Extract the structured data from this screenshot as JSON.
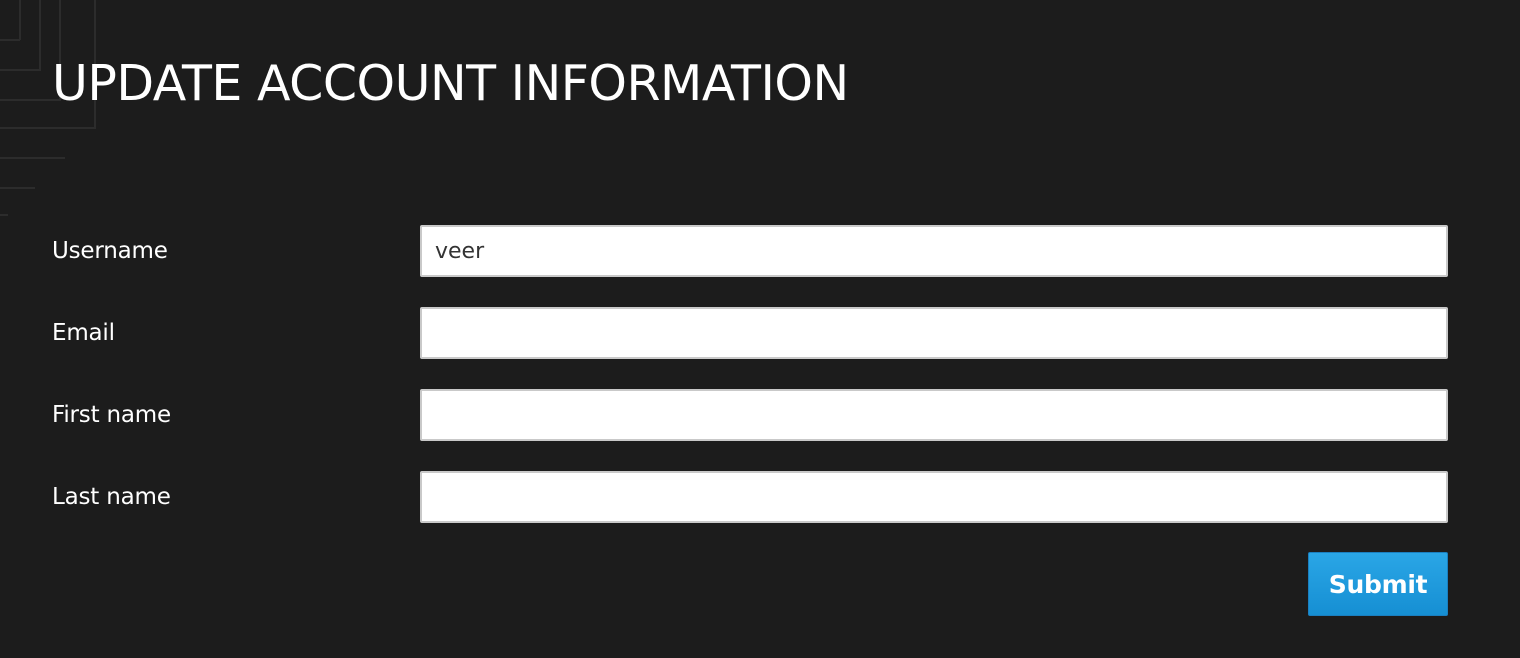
{
  "page": {
    "title": "UPDATE ACCOUNT INFORMATION"
  },
  "form": {
    "fields": [
      {
        "label": "Username",
        "value": "veer",
        "placeholder": ""
      },
      {
        "label": "Email",
        "value": "",
        "placeholder": ""
      },
      {
        "label": "First name",
        "value": "",
        "placeholder": ""
      },
      {
        "label": "Last name",
        "value": "",
        "placeholder": ""
      }
    ],
    "submit_label": "Submit"
  },
  "colors": {
    "background": "#1c1c1c",
    "text": "#ffffff",
    "input_background": "#ffffff",
    "input_border": "#c9c9c9",
    "button_accent": "#1e97dc"
  }
}
